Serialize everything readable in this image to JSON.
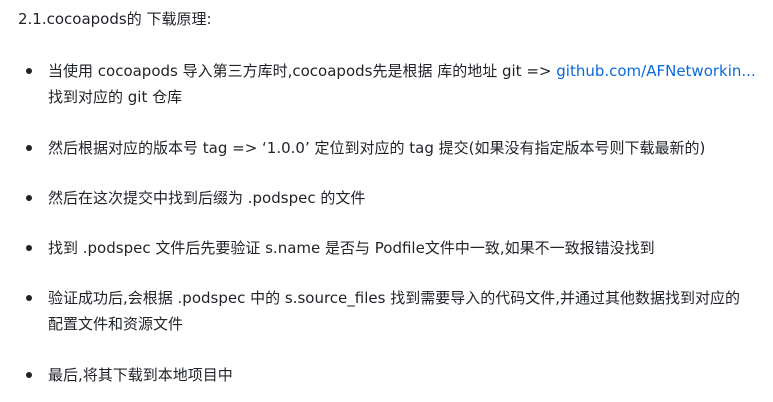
{
  "heading": "2.1.cocoapods的 下载原理:",
  "items": [
    {
      "text": "当使用 cocoapods 导入第三方库时,cocoapods先是根据 库的地址 git => ",
      "link": "github.com/AFNetworkin...",
      "cont": "找到对应的 git 仓库"
    },
    {
      "text": "然后根据对应的版本号 tag => ‘1.0.0’ 定位到对应的 tag 提交(如果没有指定版本号则下载最新的)"
    },
    {
      "text": "然后在这次提交中找到后缀为 .podspec 的文件"
    },
    {
      "text": "找到 .podspec 文件后先要验证 s.name 是否与 Podfile文件中一致,如果不一致报错没找到"
    },
    {
      "text": "验证成功后,会根据 .podspec 中的 s.source_files 找到需要导入的代码文件,并通过其他数据找到对应的",
      "cont": "配置文件和资源文件"
    },
    {
      "text": "最后,将其下载到本地项目中"
    }
  ],
  "colors": {
    "text": "#1f2328",
    "link": "#0969da",
    "background": "#ffffff"
  }
}
